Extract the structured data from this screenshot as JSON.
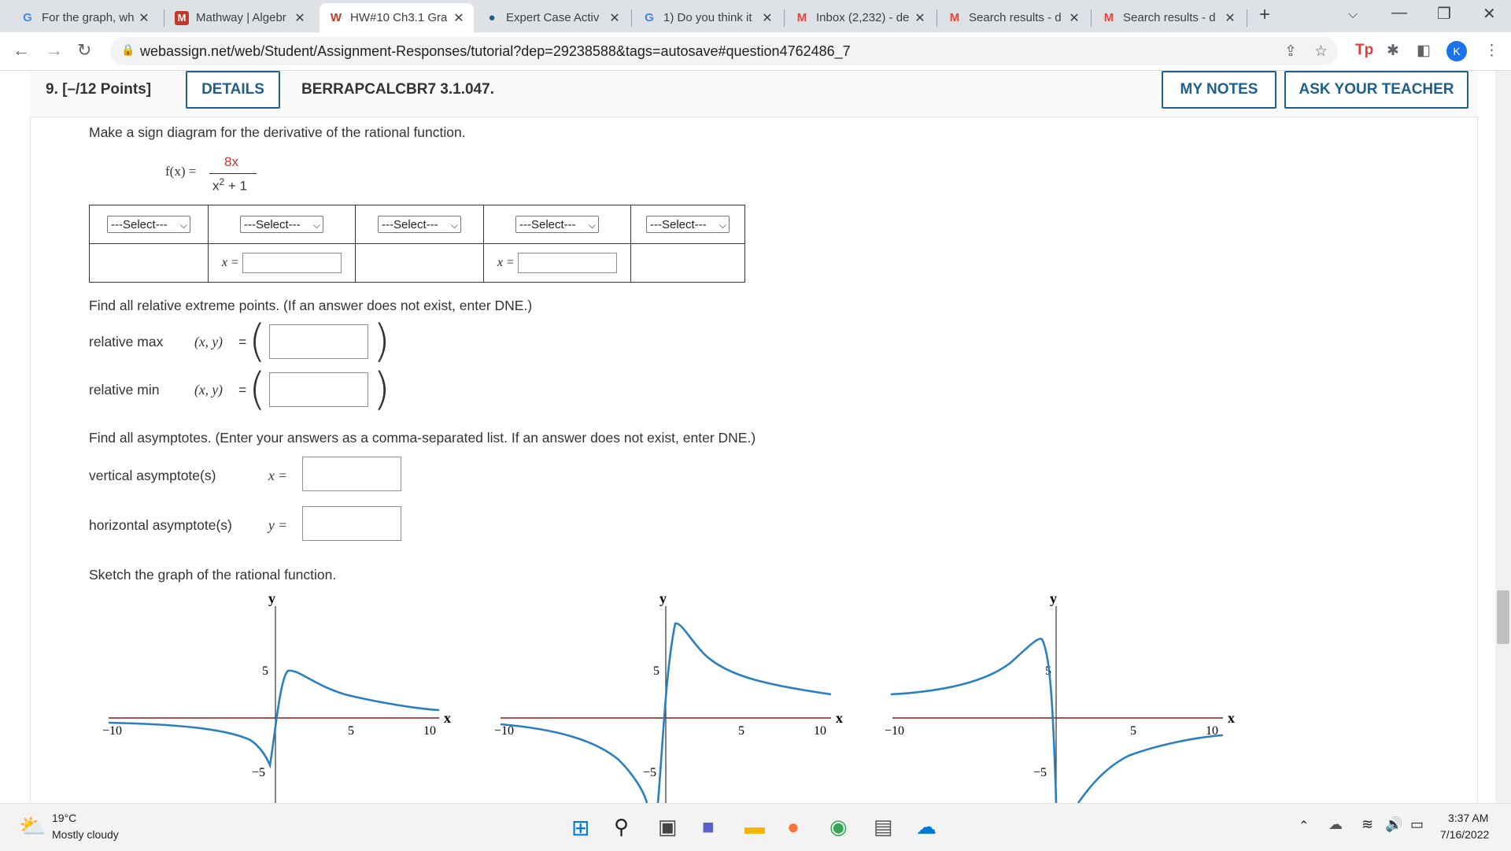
{
  "browser": {
    "tabs": [
      {
        "title": "For the graph, wh",
        "icon": "google-icon",
        "fav": "G",
        "color": "#4285f4"
      },
      {
        "title": "Mathway | Algebr",
        "icon": "mathway-icon",
        "fav": "M",
        "color": "#c0392b"
      },
      {
        "title": "HW#10 Ch3.1 Gra",
        "icon": "webassign-icon",
        "fav": "W",
        "color": "#c0392b"
      },
      {
        "title": "Expert Case Activ",
        "icon": "chegg-icon",
        "fav": "●",
        "color": "#1f5f8b"
      },
      {
        "title": "1) Do you think it",
        "icon": "google-icon",
        "fav": "G",
        "color": "#4285f4"
      },
      {
        "title": "Inbox (2,232) - de",
        "icon": "gmail-icon",
        "fav": "M",
        "color": "#ea4335"
      },
      {
        "title": "Search results - d",
        "icon": "gmail-icon",
        "fav": "M",
        "color": "#ea4335"
      },
      {
        "title": "Search results - d",
        "icon": "gmail-icon",
        "fav": "M",
        "color": "#ea4335"
      }
    ],
    "url": "webassign.net/web/Student/Assignment-Responses/tutorial?dep=29238588&tags=autosave#question4762486_7",
    "avatar_letter": "K"
  },
  "question": {
    "number": "9.  [–/12 Points]",
    "details_label": "DETAILS",
    "code": "BERRAPCALCBR7 3.1.047.",
    "my_notes_label": "MY NOTES",
    "ask_teacher_label": "ASK YOUR TEACHER",
    "prompt": "Make a sign diagram for the derivative of the rational function.",
    "function_lhs": "f(x) =",
    "numerator": "8x",
    "denominator_base": "x",
    "denominator_exp": "2",
    "denominator_rest": " + 1",
    "select_placeholder": "---Select---",
    "x_eq_label": "x =",
    "extreme_prompt": "Find all relative extreme points. (If an answer does not exist, enter DNE.)",
    "rel_max_label": "relative max",
    "rel_min_label": "relative min",
    "xy_label": "(x, y)",
    "eq": "=",
    "asymptote_prompt": "Find all asymptotes. (Enter your answers as a comma-separated list. If an answer does not exist, enter DNE.)",
    "vertical_label": "vertical asymptote(s)",
    "vertical_var": "x =",
    "horizontal_label": "horizontal asymptote(s)",
    "horizontal_var": "y =",
    "sketch_prompt": "Sketch the graph of the rational function."
  },
  "graphs": {
    "y_label": "y",
    "x_label": "x",
    "ticks": [
      "5",
      "−5",
      "−10",
      "5",
      "10"
    ]
  },
  "taskbar": {
    "temperature": "19°C",
    "weather": "Mostly cloudy",
    "time": "3:37 AM",
    "date": "7/16/2022"
  }
}
